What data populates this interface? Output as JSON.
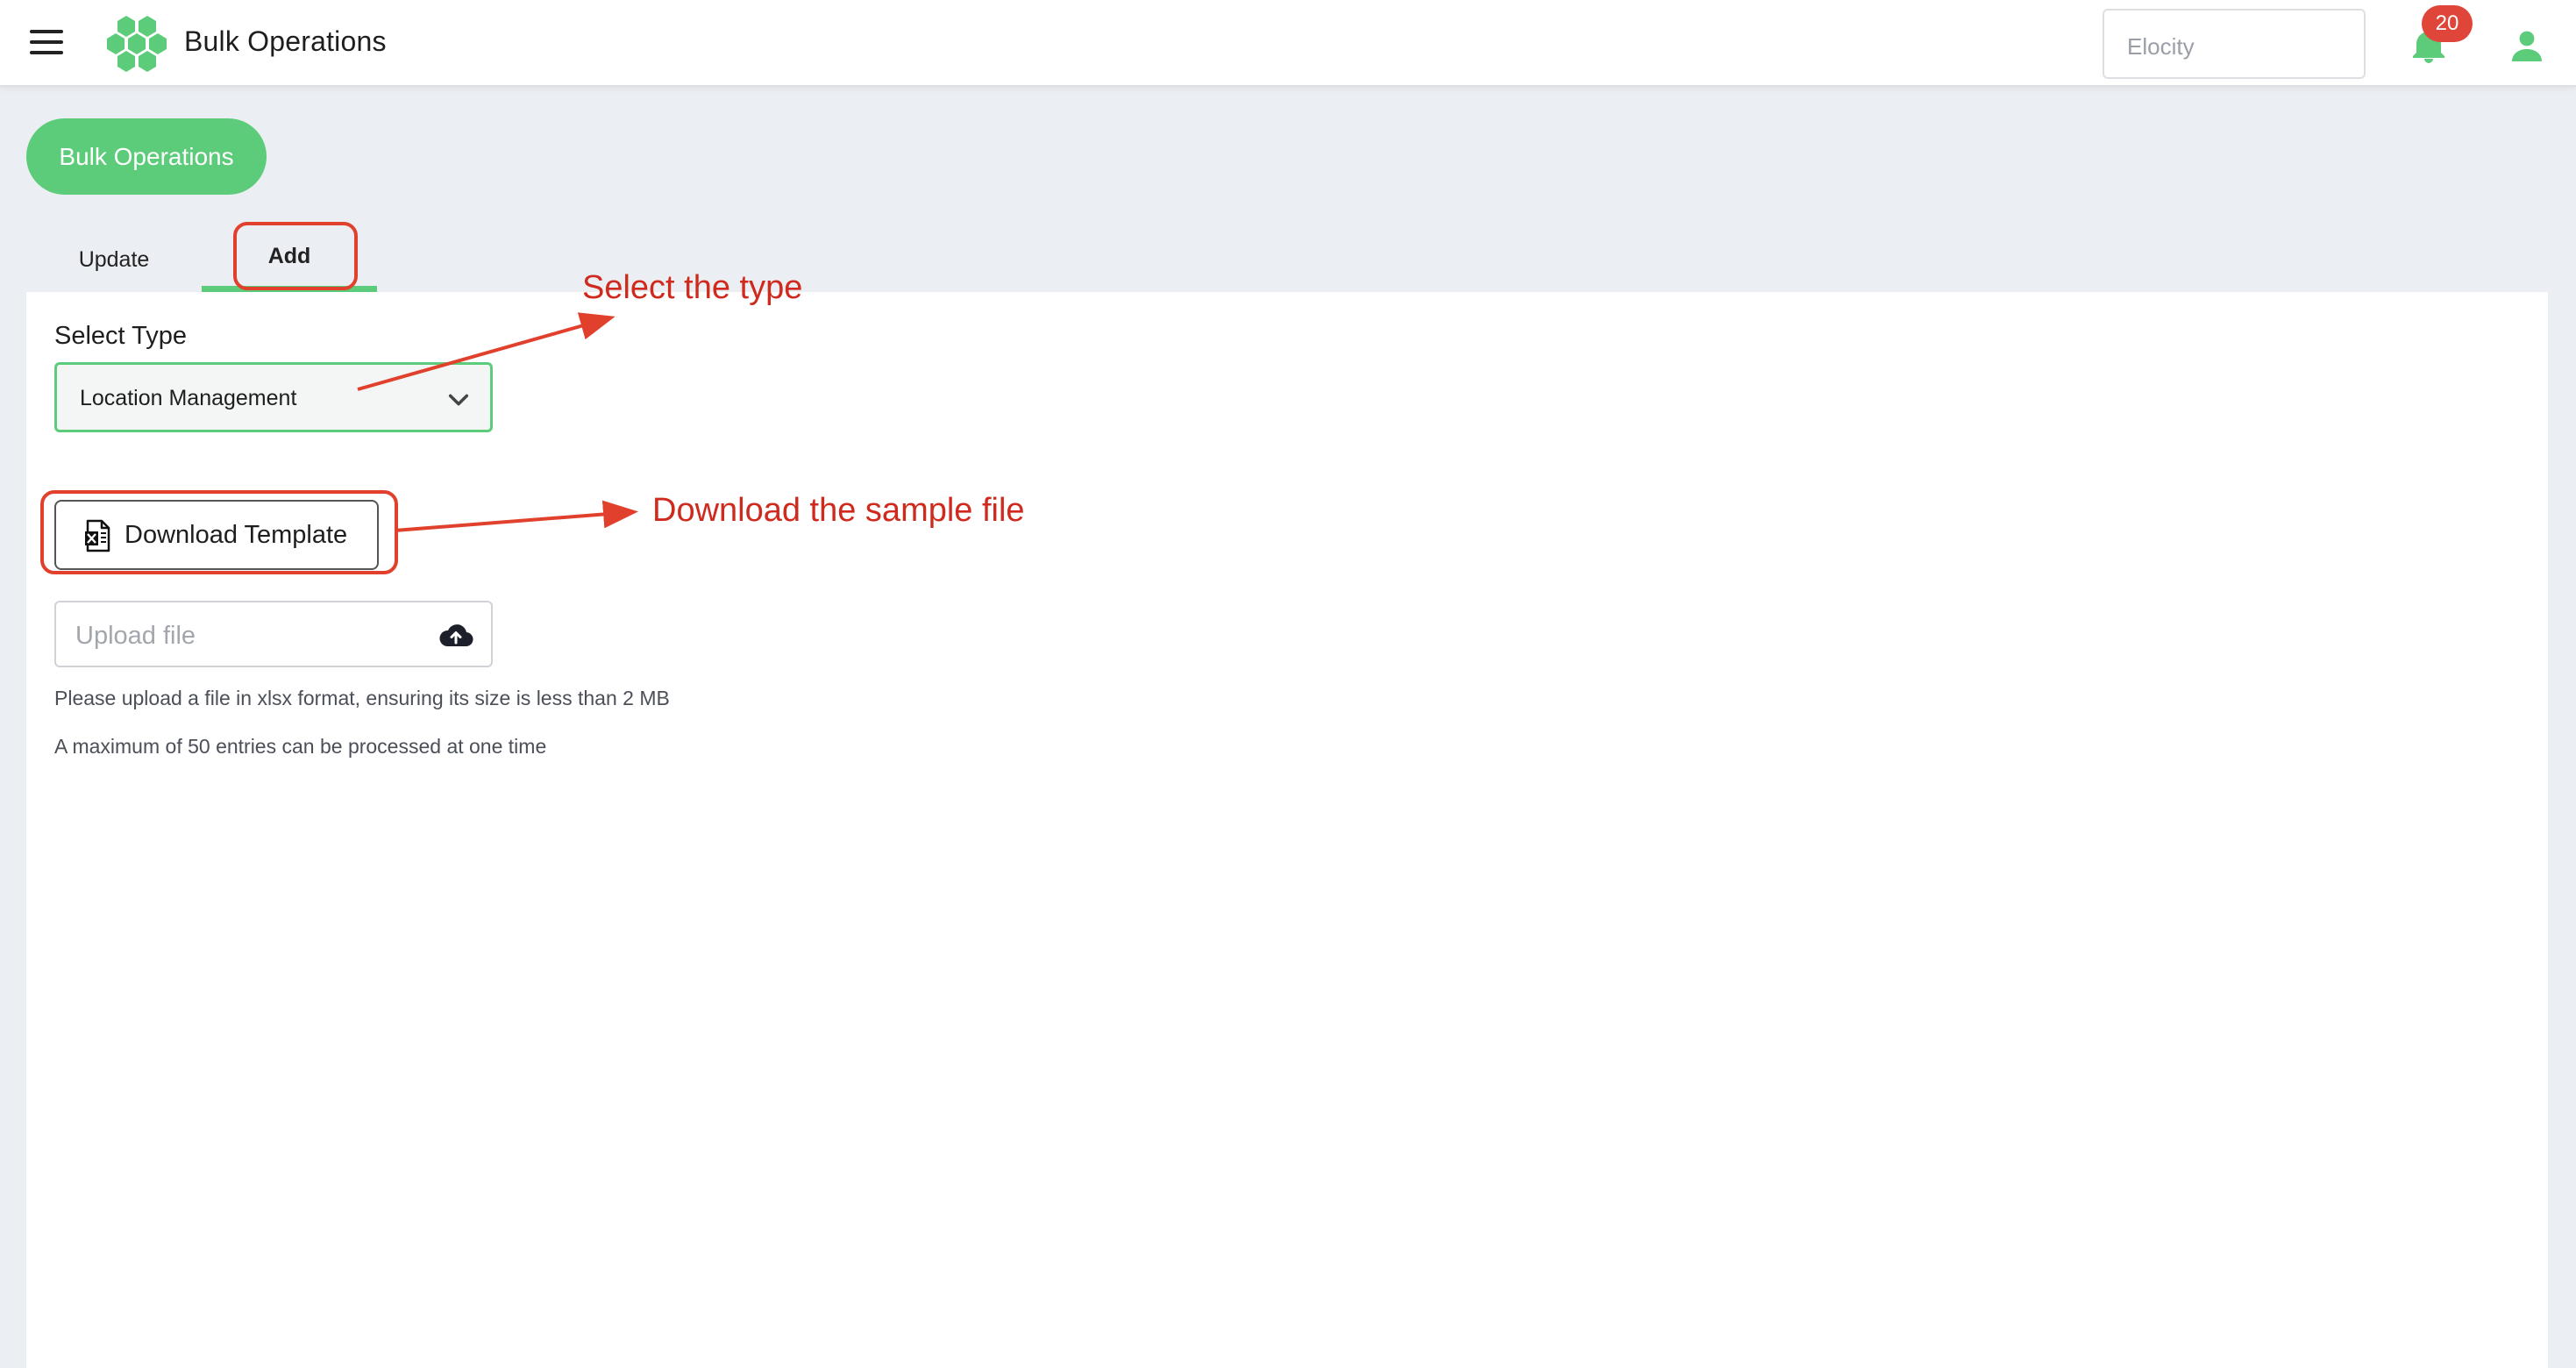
{
  "header": {
    "title": "Bulk Operations",
    "org_selector": "Elocity",
    "notification_count": "20",
    "icons": [
      "menu-icon",
      "logo-honeycomb-icon",
      "bell-icon",
      "user-icon"
    ]
  },
  "page": {
    "pill_label": "Bulk Operations"
  },
  "tabs": [
    {
      "label": "Update",
      "active": false
    },
    {
      "label": "Add",
      "active": true
    }
  ],
  "form": {
    "select_type_label": "Select Type",
    "select_type_value": "Location Management",
    "download_button_label": "Download Template",
    "upload_placeholder": "Upload file",
    "hints": [
      "Please upload a file in xlsx format, ensuring its size is less than 2 MB",
      "A maximum of 50 entries can be processed at one time"
    ]
  },
  "annotations": {
    "select_note": "Select the type",
    "download_note": "Download the sample file"
  },
  "colors": {
    "accent": "#5ccc7a",
    "annotation": "#e1412c",
    "badge": "#e0453a"
  }
}
